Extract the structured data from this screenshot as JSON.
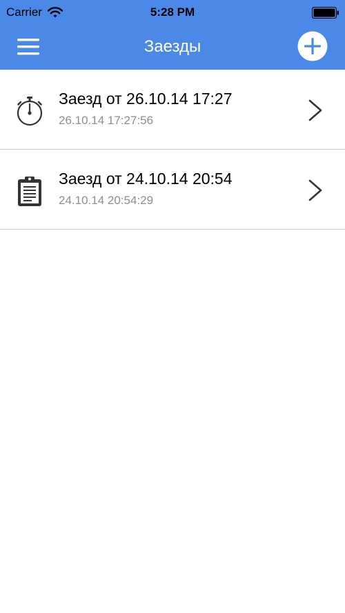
{
  "status_bar": {
    "carrier": "Carrier",
    "time": "5:28 PM",
    "wifi_icon": "wifi-icon",
    "battery_icon": "battery-icon"
  },
  "nav_bar": {
    "title": "Заезды",
    "menu_icon": "hamburger-menu-icon",
    "add_icon": "plus-circle-icon"
  },
  "colors": {
    "header_bg": "#4a89e8",
    "title_text": "#000000",
    "subtitle_text": "#8e8e93",
    "separator": "#c8c7cc"
  },
  "rides": [
    {
      "icon": "stopwatch-icon",
      "title": "Заезд от 26.10.14 17:27",
      "subtitle": "26.10.14 17:27:56"
    },
    {
      "icon": "clipboard-icon",
      "title": "Заезд от 24.10.14 20:54",
      "subtitle": "24.10.14 20:54:29"
    }
  ]
}
